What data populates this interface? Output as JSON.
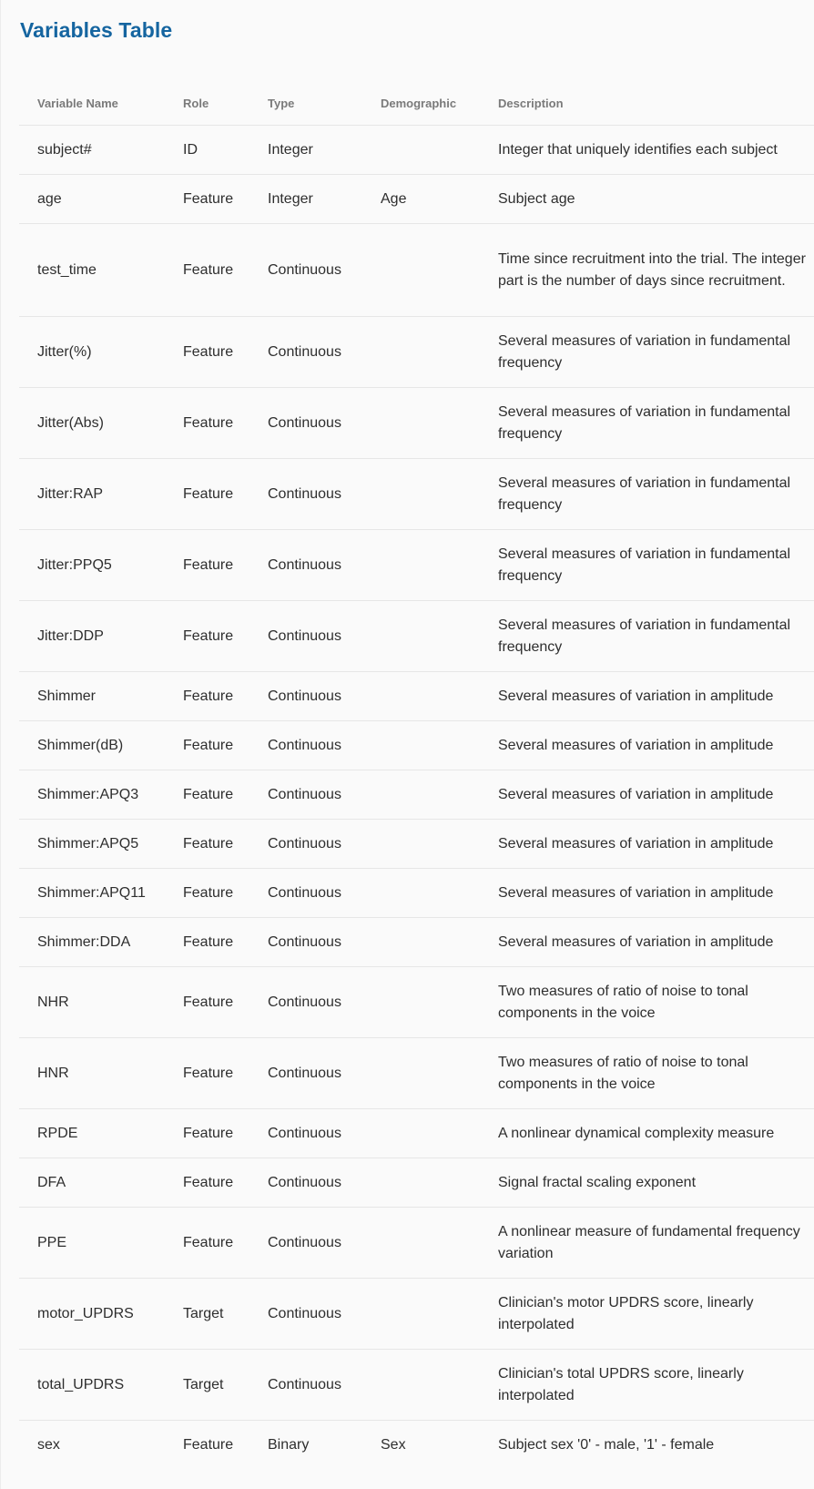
{
  "title": "Variables Table",
  "columns": {
    "name": "Variable Name",
    "role": "Role",
    "type": "Type",
    "demographic": "Demographic",
    "description": "Description"
  },
  "rows": [
    {
      "name": "subject#",
      "role": "ID",
      "type": "Integer",
      "demographic": "",
      "description": "Integer that uniquely identifies each subject"
    },
    {
      "name": "age",
      "role": "Feature",
      "type": "Integer",
      "demographic": "Age",
      "description": "Subject age"
    },
    {
      "name": "test_time",
      "role": "Feature",
      "type": "Continuous",
      "demographic": "",
      "description": "Time since recruitment into the trial. The integer part is the number of days since recruitment."
    },
    {
      "name": "Jitter(%)",
      "role": "Feature",
      "type": "Continuous",
      "demographic": "",
      "description": "Several measures of variation in fundamental frequency"
    },
    {
      "name": "Jitter(Abs)",
      "role": "Feature",
      "type": "Continuous",
      "demographic": "",
      "description": "Several measures of variation in fundamental frequency"
    },
    {
      "name": "Jitter:RAP",
      "role": "Feature",
      "type": "Continuous",
      "demographic": "",
      "description": "Several measures of variation in fundamental frequency"
    },
    {
      "name": "Jitter:PPQ5",
      "role": "Feature",
      "type": "Continuous",
      "demographic": "",
      "description": "Several measures of variation in fundamental frequency"
    },
    {
      "name": "Jitter:DDP",
      "role": "Feature",
      "type": "Continuous",
      "demographic": "",
      "description": "Several measures of variation in fundamental frequency"
    },
    {
      "name": "Shimmer",
      "role": "Feature",
      "type": "Continuous",
      "demographic": "",
      "description": "Several measures of variation in amplitude"
    },
    {
      "name": "Shimmer(dB)",
      "role": "Feature",
      "type": "Continuous",
      "demographic": "",
      "description": "Several measures of variation in amplitude"
    },
    {
      "name": "Shimmer:APQ3",
      "role": "Feature",
      "type": "Continuous",
      "demographic": "",
      "description": "Several measures of variation in amplitude"
    },
    {
      "name": "Shimmer:APQ5",
      "role": "Feature",
      "type": "Continuous",
      "demographic": "",
      "description": "Several measures of variation in amplitude"
    },
    {
      "name": "Shimmer:APQ11",
      "role": "Feature",
      "type": "Continuous",
      "demographic": "",
      "description": "Several measures of variation in amplitude"
    },
    {
      "name": "Shimmer:DDA",
      "role": "Feature",
      "type": "Continuous",
      "demographic": "",
      "description": "Several measures of variation in amplitude"
    },
    {
      "name": "NHR",
      "role": "Feature",
      "type": "Continuous",
      "demographic": "",
      "description": "Two measures of ratio of noise to tonal components in the voice"
    },
    {
      "name": "HNR",
      "role": "Feature",
      "type": "Continuous",
      "demographic": "",
      "description": "Two measures of ratio of noise to tonal components in the voice"
    },
    {
      "name": "RPDE",
      "role": "Feature",
      "type": "Continuous",
      "demographic": "",
      "description": "A nonlinear dynamical complexity measure"
    },
    {
      "name": "DFA",
      "role": "Feature",
      "type": "Continuous",
      "demographic": "",
      "description": "Signal fractal scaling exponent"
    },
    {
      "name": "PPE",
      "role": "Feature",
      "type": "Continuous",
      "demographic": "",
      "description": "A nonlinear measure of fundamental frequency variation"
    },
    {
      "name": "motor_UPDRS",
      "role": "Target",
      "type": "Continuous",
      "demographic": "",
      "description": "Clinician's motor UPDRS score, linearly interpolated"
    },
    {
      "name": "total_UPDRS",
      "role": "Target",
      "type": "Continuous",
      "demographic": "",
      "description": "Clinician's total UPDRS score, linearly interpolated"
    },
    {
      "name": "sex",
      "role": "Feature",
      "type": "Binary",
      "demographic": "Sex",
      "description": "Subject sex '0' - male, '1' - female"
    }
  ]
}
